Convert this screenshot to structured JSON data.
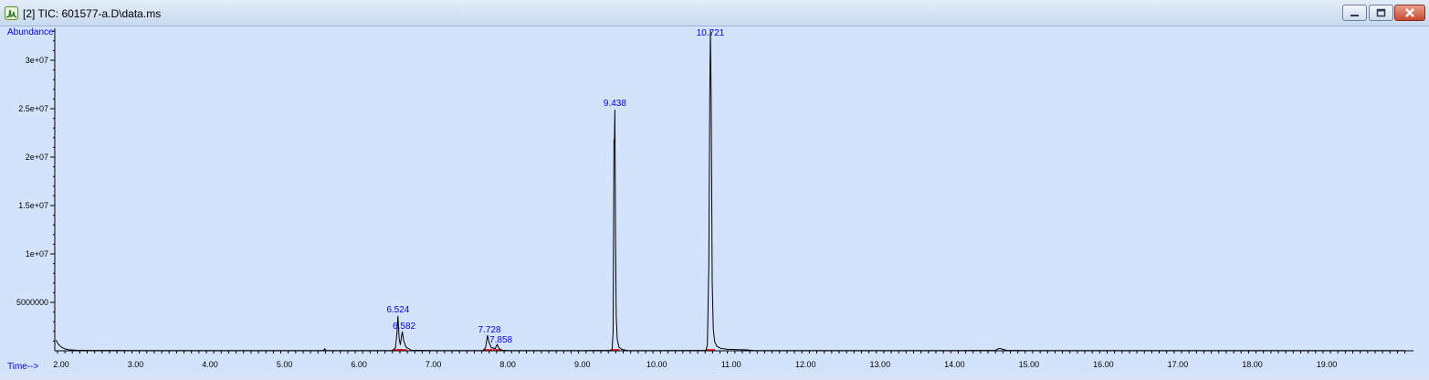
{
  "window": {
    "title": "[2] TIC: 601577-a.D\\data.ms",
    "app_icon": "chromatogram-app-icon",
    "buttons": [
      "minimize-icon",
      "maximize-icon",
      "close-icon"
    ]
  },
  "colors": {
    "background": "#d4e3fc",
    "trace": "#000000",
    "label": "#0000ee",
    "baseline_marker": "#e00000"
  },
  "chart_data": {
    "type": "line",
    "ylabel": "Abundance",
    "xlabel": "Time-->",
    "xlim": [
      1.93,
      20.05
    ],
    "ylim": [
      0,
      33700000
    ],
    "x_ticks": [
      2,
      3,
      4,
      5,
      6,
      7,
      8,
      9,
      10,
      11,
      12,
      13,
      14,
      15,
      16,
      17,
      18,
      19
    ],
    "x_tick_labels": [
      "2.00",
      "3.00",
      "4.00",
      "5.00",
      "6.00",
      "7.00",
      "8.00",
      "9.00",
      "10.00",
      "11.00",
      "12.00",
      "13.00",
      "14.00",
      "15.00",
      "16.00",
      "17.00",
      "18.00",
      "19.00"
    ],
    "y_ticks": [
      5000000,
      10000000,
      15000000,
      20000000,
      25000000,
      30000000
    ],
    "y_tick_labels": [
      "5000000",
      "1e+07",
      "1.5e+07",
      "2e+07",
      "2.5e+07",
      "3e+07"
    ],
    "peaks": [
      {
        "rt": 6.524,
        "label": "6.524",
        "height": 3600000
      },
      {
        "rt": 6.582,
        "label": "6.582",
        "height": 2000000
      },
      {
        "rt": 7.728,
        "label": "7.728",
        "height": 1600000
      },
      {
        "rt": 7.858,
        "label": "7.858",
        "height": 650000
      },
      {
        "rt": 9.438,
        "label": "9.438",
        "height": 24900000
      },
      {
        "rt": 10.721,
        "label": "10.721",
        "height": 33100000
      }
    ],
    "trace": {
      "x": [
        1.93,
        1.96,
        2.0,
        2.05,
        2.1,
        2.2,
        2.4,
        3.0,
        4.0,
        5.0,
        5.52,
        5.54,
        5.56,
        6.0,
        6.45,
        6.49,
        6.51,
        6.524,
        6.54,
        6.555,
        6.57,
        6.582,
        6.6,
        6.63,
        6.7,
        7.0,
        7.67,
        7.7,
        7.715,
        7.728,
        7.745,
        7.78,
        7.83,
        7.858,
        7.88,
        7.92,
        8.0,
        9.0,
        9.4,
        9.415,
        9.425,
        9.432,
        9.438,
        9.446,
        9.456,
        9.47,
        9.49,
        9.53,
        9.6,
        10.0,
        10.66,
        10.68,
        10.7,
        10.712,
        10.721,
        10.732,
        10.745,
        10.76,
        10.78,
        10.81,
        10.86,
        10.95,
        11.2,
        11.3,
        12.0,
        13.0,
        14.0,
        14.55,
        14.6,
        14.65,
        14.7,
        15.0,
        16.0,
        17.0,
        18.0,
        19.0,
        20.05
      ],
      "y": [
        1100000,
        700000,
        400000,
        200000,
        100000,
        60000,
        40000,
        30000,
        30000,
        30000,
        30000,
        200000,
        30000,
        30000,
        40000,
        300000,
        1800000,
        3600000,
        1300000,
        600000,
        1400000,
        2000000,
        1100000,
        400000,
        60000,
        30000,
        30000,
        300000,
        1000000,
        1600000,
        900000,
        300000,
        250000,
        650000,
        250000,
        60000,
        30000,
        30000,
        50000,
        2000000,
        21800000,
        21600000,
        24900000,
        12000000,
        3500000,
        1200000,
        400000,
        150000,
        40000,
        30000,
        40000,
        600000,
        9000000,
        26000000,
        33100000,
        26000000,
        7000000,
        2200000,
        900000,
        450000,
        250000,
        150000,
        90000,
        40000,
        30000,
        30000,
        30000,
        50000,
        250000,
        150000,
        50000,
        30000,
        30000,
        30000,
        30000,
        30000,
        30000
      ]
    }
  }
}
